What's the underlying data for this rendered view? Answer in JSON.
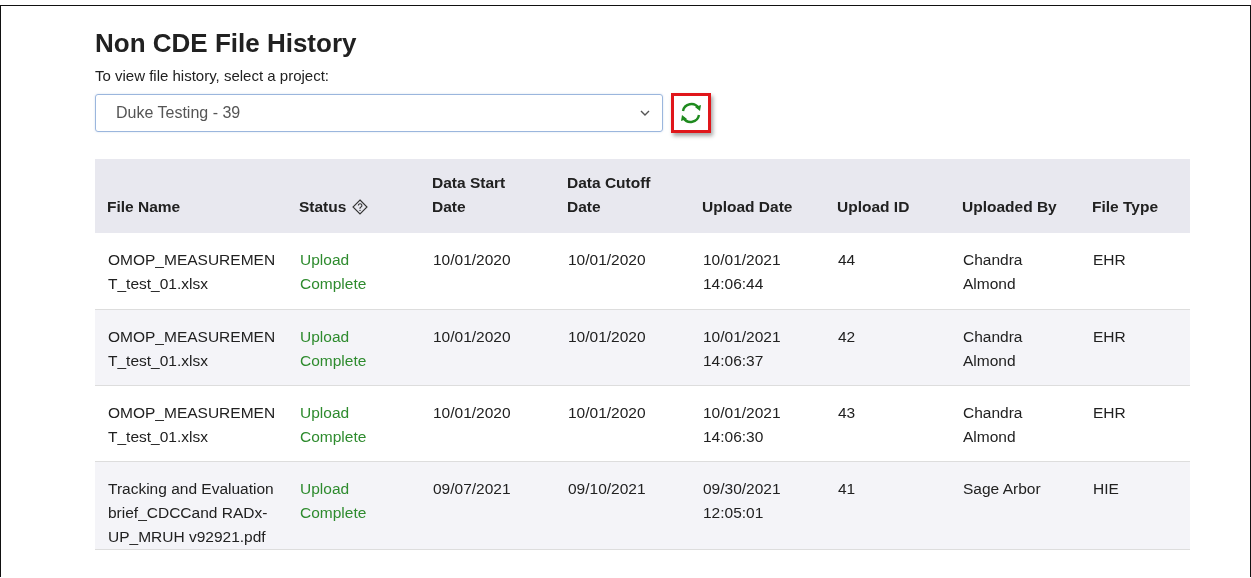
{
  "page": {
    "title": "Non CDE File History",
    "prompt": "To view file history, select a project:"
  },
  "project_select": {
    "value": "Duke Testing - 39"
  },
  "table": {
    "columns": [
      "File Name",
      "Status",
      "Data Start Date",
      "Data Cutoff Date",
      "Upload Date",
      "Upload ID",
      "Uploaded By",
      "File Type"
    ],
    "rows": [
      {
        "file_name": "OMOP_MEASUREMENT_test_01.xlsx",
        "status": "Upload Complete",
        "data_start_date": "10/01/2020",
        "data_cutoff_date": "10/01/2020",
        "upload_date": "10/01/2021 14:06:44",
        "upload_id": "44",
        "uploaded_by": "Chandra Almond",
        "file_type": "EHR"
      },
      {
        "file_name": "OMOP_MEASUREMENT_test_01.xlsx",
        "status": "Upload Complete",
        "data_start_date": "10/01/2020",
        "data_cutoff_date": "10/01/2020",
        "upload_date": "10/01/2021 14:06:37",
        "upload_id": "42",
        "uploaded_by": "Chandra Almond",
        "file_type": "EHR"
      },
      {
        "file_name": "OMOP_MEASUREMENT_test_01.xlsx",
        "status": "Upload Complete",
        "data_start_date": "10/01/2020",
        "data_cutoff_date": "10/01/2020",
        "upload_date": "10/01/2021 14:06:30",
        "upload_id": "43",
        "uploaded_by": "Chandra Almond",
        "file_type": "EHR"
      },
      {
        "file_name": "Tracking and Evaluation brief_CDCCand RADx-UP_MRUH v92921.pdf",
        "status": "Upload Complete",
        "data_start_date": "09/07/2021",
        "data_cutoff_date": "09/10/2021",
        "upload_date": "09/30/2021 12:05:01",
        "upload_id": "41",
        "uploaded_by": "Sage Arbor",
        "file_type": "HIE"
      }
    ]
  }
}
